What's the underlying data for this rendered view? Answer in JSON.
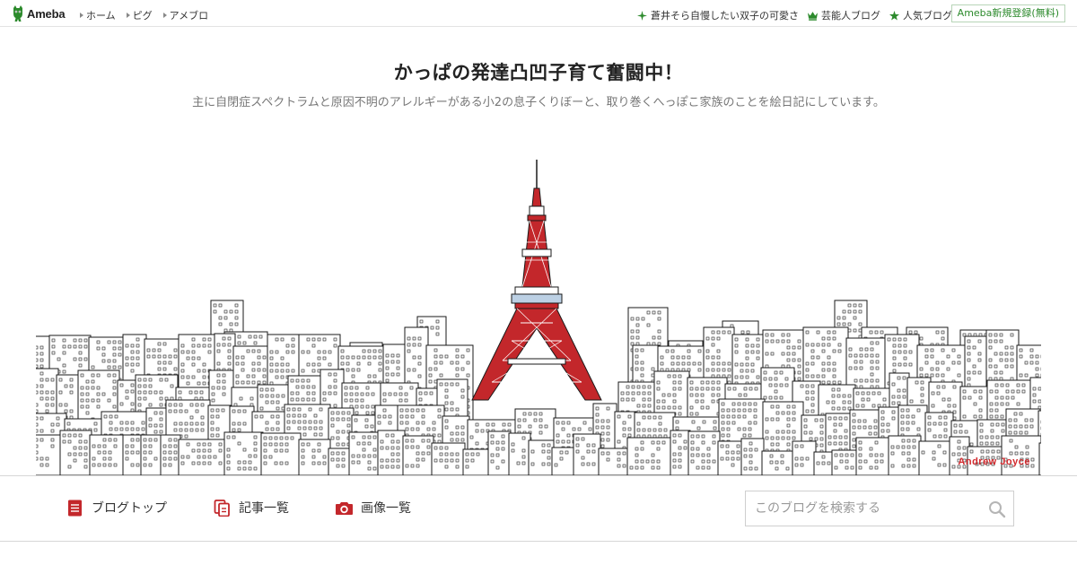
{
  "topbar": {
    "logo_text": "Ameba",
    "nav": [
      {
        "label": "ホーム"
      },
      {
        "label": "ピグ"
      },
      {
        "label": "アメブロ"
      }
    ],
    "right_links": [
      {
        "label": "蒼井そら自慢したい双子の可愛さ",
        "icon": "sparkle-icon"
      },
      {
        "label": "芸能人ブログ",
        "icon": "crown-icon"
      },
      {
        "label": "人気ブログ",
        "icon": "star-icon"
      }
    ],
    "signup_label": "Ameba新規登録(無料)"
  },
  "header": {
    "title": "かっぱの発達凸凹子育て奮闘中！",
    "description": "主に自閉症スペクトラムと原因不明のアレルギーがある小2の息子くりぼーと、取り巻くへっぽこ家族のことを絵日記にしています。"
  },
  "hero": {
    "credit": "Andrew Joyce",
    "accent_color": "#d2292d"
  },
  "blog_nav": {
    "items": [
      {
        "label": "ブログトップ",
        "icon": "document-icon"
      },
      {
        "label": "記事一覧",
        "icon": "pages-icon"
      },
      {
        "label": "画像一覧",
        "icon": "camera-icon"
      }
    ],
    "search_placeholder": "このブログを検索する"
  },
  "colors": {
    "brand_green": "#2c8a2c",
    "accent_red": "#c3272b"
  }
}
